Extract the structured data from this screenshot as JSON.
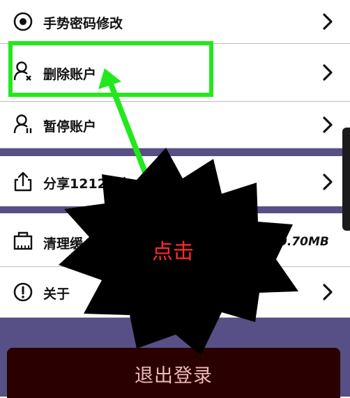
{
  "menu": {
    "items": [
      {
        "label": "手势密码修改",
        "icon": "target-circle-icon"
      },
      {
        "label": "删除账户",
        "icon": "user-remove-icon"
      },
      {
        "label": "暂停账户",
        "icon": "user-pause-icon"
      },
      {
        "label": "分享12123给",
        "icon": "share-icon"
      },
      {
        "label": "清理缓",
        "icon": "cache-icon",
        "value": "0.70MB"
      },
      {
        "label": "关于",
        "icon": "info-icon"
      }
    ]
  },
  "overlay": {
    "burst_text": "点击",
    "highlight_color": "#22e81c",
    "arrow_color": "#22e81c",
    "burst_text_color": "#ff2a2a"
  },
  "logout": {
    "label": "退出登录",
    "bg": "#2a0000"
  },
  "colors": {
    "band": "#565086",
    "divider": "#bdbdbd"
  }
}
